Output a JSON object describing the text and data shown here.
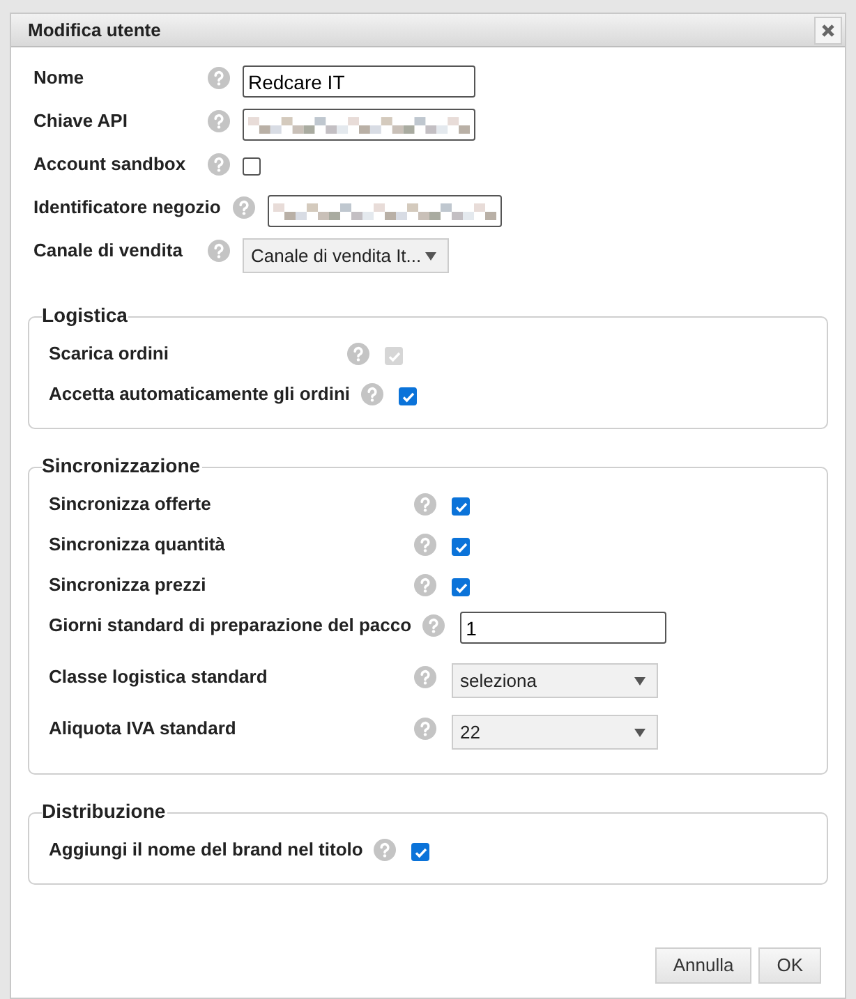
{
  "dialog": {
    "title": "Modifica utente"
  },
  "fields": [
    {
      "label": "Nome",
      "kind": "text",
      "value": "Redcare IT"
    },
    {
      "label": "Chiave API",
      "kind": "redacted"
    },
    {
      "label": "Account sandbox",
      "kind": "checkbox",
      "checked": false,
      "disabled": false
    },
    {
      "label": "Identificatore negozio",
      "kind": "redacted"
    },
    {
      "label": "Canale di vendita",
      "kind": "select",
      "value": "Canale di vendita It..."
    }
  ],
  "sections": [
    {
      "title": "Logistica",
      "rows": [
        {
          "label": "Scarica ordini",
          "kind": "checkbox",
          "checked": true,
          "disabled": true
        },
        {
          "label": "Accetta automaticamente gli ordini",
          "kind": "checkbox",
          "checked": true,
          "disabled": false
        }
      ]
    },
    {
      "title": "Sincronizzazione",
      "rows": [
        {
          "label": "Sincronizza offerte",
          "kind": "checkbox",
          "checked": true,
          "disabled": false
        },
        {
          "label": "Sincronizza quantità",
          "kind": "checkbox",
          "checked": true,
          "disabled": false
        },
        {
          "label": "Sincronizza prezzi",
          "kind": "checkbox",
          "checked": true,
          "disabled": false
        },
        {
          "label": "Giorni standard di preparazione del pacco",
          "kind": "text",
          "value": "1"
        },
        {
          "label": "Classe logistica standard",
          "kind": "select",
          "value": "seleziona"
        },
        {
          "label": "Aliquota IVA standard",
          "kind": "select",
          "value": "22"
        }
      ]
    },
    {
      "title": "Distribuzione",
      "rows": [
        {
          "label": "Aggiungi il nome del brand nel titolo",
          "kind": "checkbox",
          "checked": true,
          "disabled": false
        }
      ]
    }
  ],
  "buttons": [
    "Annulla",
    "OK"
  ]
}
